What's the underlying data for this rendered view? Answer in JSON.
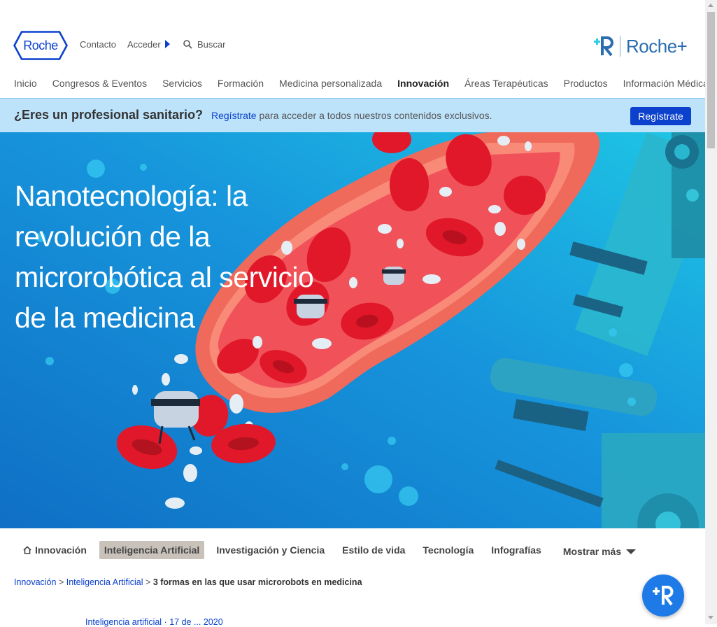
{
  "header": {
    "logo_text": "Roche",
    "contact": "Contacto",
    "login": "Acceder",
    "search": "Buscar",
    "roche_plus": "Roche+"
  },
  "nav": {
    "items": [
      "Inicio",
      "Congresos & Eventos",
      "Servicios",
      "Formación",
      "Medicina personalizada",
      "Innovación",
      "Áreas Terapéuticas",
      "Productos",
      "Información Médica"
    ],
    "active": "Innovación"
  },
  "banner": {
    "question": "¿Eres un profesional sanitario?",
    "link": "Regístrate",
    "text": " para acceder a todos nuestros contenidos exclusivos.",
    "button": "Regístrate"
  },
  "hero": {
    "title": "Nanotecnología: la revolución de la microrobótica al servicio de la medicina"
  },
  "subnav": {
    "items": [
      "Innovación",
      "Inteligencia Artificial",
      "Investigación y Ciencia",
      "Estilo de vida",
      "Tecnología",
      "Infografías"
    ],
    "active": "Inteligencia Artificial",
    "more": "Mostrar más"
  },
  "breadcrumb": {
    "items": [
      "Innovación",
      "Inteligencia Artificial"
    ],
    "separator": ">",
    "current": "3 formas en las que usar microrobots en medicina"
  },
  "article_meta": "Inteligencia artificial · 17 de ... 2020",
  "colors": {
    "brand_blue": "#0b41cd",
    "banner_bg": "#bde3fb",
    "hero_blue": "#1b8fd8",
    "active_tab_bg": "#c9c2bb"
  }
}
